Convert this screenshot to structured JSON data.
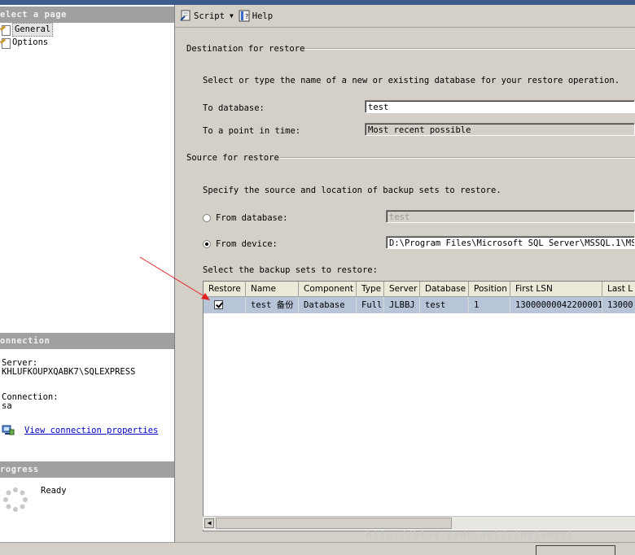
{
  "left": {
    "select_page_header": "elect a page",
    "pages": [
      {
        "label": "General",
        "selected": true
      },
      {
        "label": "Options",
        "selected": false
      }
    ],
    "connection_header": "onnection",
    "server_label": "Server:",
    "server_value": "KHLUFKOUPXQABK7\\SQLEXPRESS",
    "connection_label": "Connection:",
    "connection_value": "sa",
    "view_connection_link": "View connection properties",
    "progress_header": "rogress",
    "progress_status": "Ready"
  },
  "toolbar": {
    "script_label": "Script",
    "help_label": "Help"
  },
  "destination": {
    "group_title": "Destination for restore",
    "instruction": "Select or type the name of a new or existing database for your restore operation.",
    "to_database_label": "To database:",
    "to_database_value": "test",
    "to_point_label": "To a point in time:",
    "to_point_value": "Most recent possible"
  },
  "source": {
    "group_title": "Source for restore",
    "instruction": "Specify the source and location of backup sets to restore.",
    "from_database_label": "From database:",
    "from_database_value": "test",
    "from_device_label": "From device:",
    "from_device_value": "D:\\Program Files\\Microsoft SQL Server\\MSSQL.1\\MSSQL",
    "selected_option": "From device",
    "backup_sets_label": "Select the backup sets to restore:"
  },
  "grid": {
    "columns": [
      "Restore",
      "Name",
      "Component",
      "Type",
      "Server",
      "Database",
      "Position",
      "First LSN",
      "Last L"
    ],
    "rows": [
      {
        "restore": true,
        "name": "test 备份",
        "component": "Database",
        "type": "Full",
        "server": "JLBBJ",
        "database": "test",
        "position": "1",
        "first_lsn": "13000000042200001",
        "last_lsn": "13000"
      }
    ]
  },
  "watermark": "http://blog.csdn.net/yingtangri",
  "colors": {
    "section_header": "#a0a0a0",
    "selected_row": "#b8c4d8",
    "arrow": "#e02020",
    "link": "#0000cc"
  }
}
